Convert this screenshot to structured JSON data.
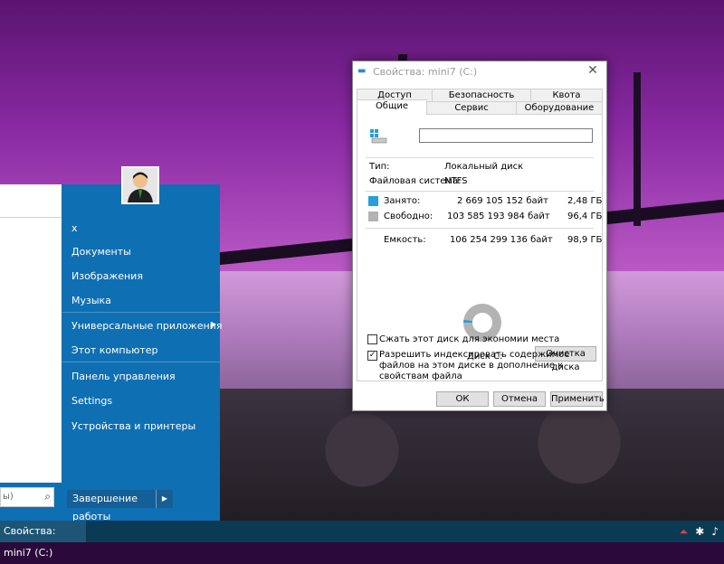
{
  "taskbar": {
    "active_item": "Свойства: mini7 (C:)"
  },
  "start_menu": {
    "search_placeholder": "ы)",
    "items": [
      {
        "label": "x"
      },
      {
        "label": "Документы"
      },
      {
        "label": "Изображения"
      },
      {
        "label": "Музыка"
      },
      {
        "label": "Универсальные приложения",
        "submenu": true
      },
      {
        "label": "Этот компьютер"
      },
      {
        "label": "Панель управления"
      },
      {
        "label": "Settings"
      },
      {
        "label": "Устройства и принтеры"
      }
    ],
    "shutdown_label": "Завершение работы"
  },
  "window": {
    "title": "Свойства: mini7 (C:)",
    "tabs_top": [
      "Доступ",
      "Безопасность",
      "Квота"
    ],
    "tabs_bottom": [
      "Общие",
      "Сервис",
      "Оборудование"
    ],
    "active_tab": "Общие",
    "drive_name_value": "",
    "type_label": "Тип:",
    "type_value": "Локальный диск",
    "fs_label": "Файловая система:",
    "fs_value": "NTFS",
    "used_label": "Занято:",
    "used_bytes": "2 669 105 152 байт",
    "used_gb": "2,48 ГБ",
    "free_label": "Свободно:",
    "free_bytes": "103 585 193 984 байт",
    "free_gb": "96,4 ГБ",
    "capacity_label": "Емкость:",
    "capacity_bytes": "106 254 299 136 байт",
    "capacity_gb": "98,9 ГБ",
    "used_fraction": 0.0251,
    "disk_label": "Диск C:",
    "cleanup_label": "Очистка диска",
    "compress_label": "Сжать этот диск для экономии места",
    "compress_checked": false,
    "index_label": "Разрешить индексировать содержимое файлов на этом диске в дополнение к свойствам файла",
    "index_checked": true,
    "ok_label": "ОК",
    "cancel_label": "Отмена",
    "apply_label": "Применить"
  },
  "colors": {
    "used": "#26a0da",
    "free": "#b3b3b3",
    "start_bg": "#0f6fb3",
    "taskbar_bg": "#0b3a55"
  }
}
